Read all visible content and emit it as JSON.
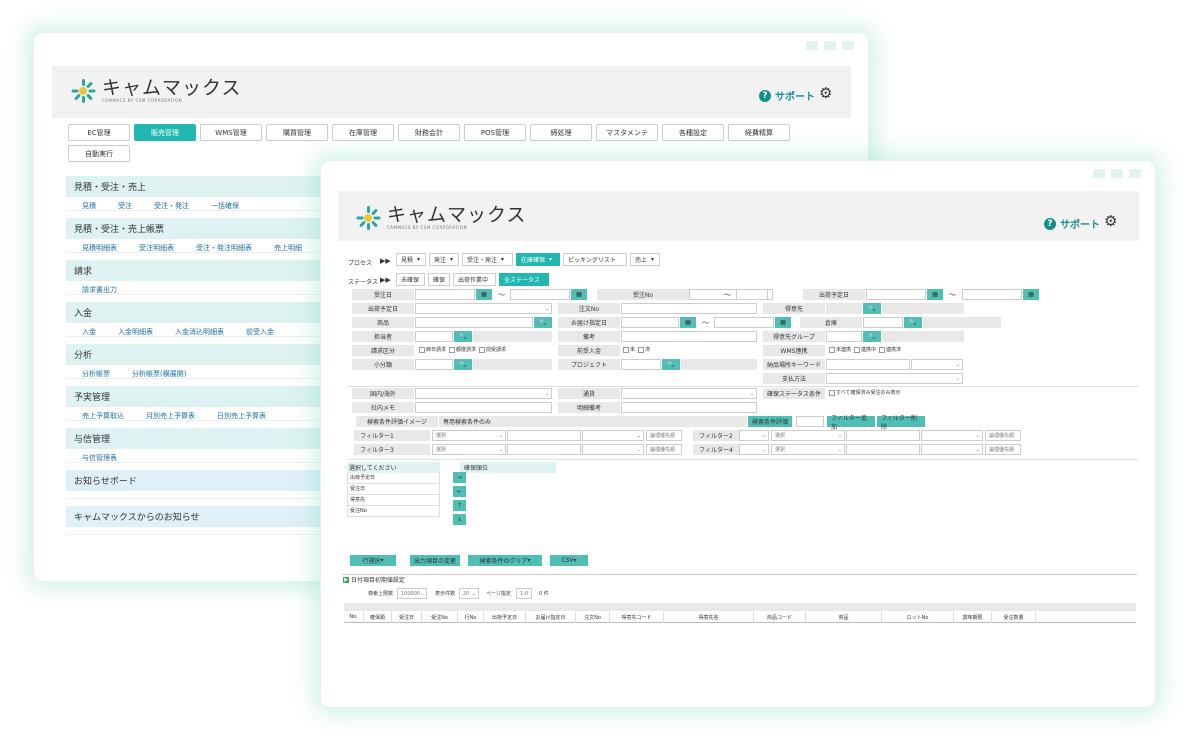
{
  "brand": {
    "name": "キャムマックス",
    "tagline": "CAMMACS BY CSM CORPORATION"
  },
  "header": {
    "support": "サポート"
  },
  "back": {
    "tabs": [
      {
        "label": "EC管理"
      },
      {
        "label": "販売管理",
        "active": true
      },
      {
        "label": "WMS管理"
      },
      {
        "label": "購買管理"
      },
      {
        "label": "在庫管理"
      },
      {
        "label": "財務会計"
      },
      {
        "label": "POS管理"
      },
      {
        "label": "締処理"
      },
      {
        "label": "マスタメンテ"
      },
      {
        "label": "各種設定"
      },
      {
        "label": "経費精算"
      },
      {
        "label": "自動実行"
      }
    ],
    "sections": [
      {
        "title": "見積・受注・売上",
        "links": [
          "見積",
          "受注",
          "受注・発注",
          "一括確保"
        ]
      },
      {
        "title": "見積・受注・売上帳票",
        "links": [
          "見積明細表",
          "受注明細表",
          "受注・発注明細表",
          "売上明細"
        ]
      },
      {
        "title": "請求",
        "links": [
          "請求書出力"
        ]
      },
      {
        "title": "入金",
        "links": [
          "入金",
          "入金明細表",
          "入金消込明細表",
          "前受入金"
        ]
      },
      {
        "title": "分析",
        "links": [
          "分析帳票",
          "分析帳票(横展開)"
        ]
      },
      {
        "title": "予実管理",
        "links": [
          "売上予算取込",
          "月別売上予算表",
          "日別売上予算表"
        ]
      },
      {
        "title": "与信管理",
        "links": [
          "与信管理表"
        ]
      },
      {
        "title": "お知らせボード",
        "links": []
      },
      {
        "title": "キャムマックスからのお知らせ",
        "links": []
      }
    ]
  },
  "front": {
    "process": {
      "label": "プロセス",
      "arrows": "▶▶",
      "buttons": [
        {
          "label": "見積",
          "drop": true
        },
        {
          "label": "発注",
          "drop": true
        },
        {
          "label": "受注・発注",
          "drop": true
        },
        {
          "label": "在庫確保",
          "drop": true,
          "active": true
        },
        {
          "label": "ピッキングリスト",
          "drop": false
        },
        {
          "label": "売上",
          "drop": true
        }
      ]
    },
    "status": {
      "label": "ステータス",
      "arrows": "▶▶",
      "buttons": [
        {
          "label": "未確保"
        },
        {
          "label": "確保"
        },
        {
          "label": "出荷作業中"
        },
        {
          "label": "全ステータス",
          "active": true
        }
      ]
    },
    "fields": {
      "juchubi": "受注日",
      "tilde": "～",
      "juchu_no": "受注No",
      "shukka_yotei": "出荷予定日",
      "shukka_yoteibi": "出荷予定日",
      "chumon_no": "注文No",
      "tokuisaki": "得意先",
      "shohin": "商品",
      "otodoke": "お届け指定日",
      "soko": "倉庫",
      "tantosha": "担当者",
      "biko": "備考",
      "tokuisaki_group": "得意先グループ",
      "seikyu_kubun": "請求区分",
      "seikyu_opts": [
        "締日請求",
        "都度請求",
        "前受請求"
      ],
      "maeuke": "前受入金",
      "maeuke_opts": [
        "未",
        "済"
      ],
      "wms": "WMS連携",
      "wms_opts": [
        "未連携",
        "連携中",
        "連携済"
      ],
      "shobunrui": "小分類",
      "project": "プロジェクト",
      "keyword": "納品場所キーワード",
      "shiharai": "支払方法",
      "kokunai": "国内/海外",
      "tsuka": "通貨",
      "kakuho_joken": "確保ステータス条件",
      "kakuho_opt": "すべて確保済み受注のみ表示",
      "shanai_memo": "社内メモ",
      "meisai_biko": "明細備考",
      "kensaku_image": "検索条件評価イメージ",
      "kensaku_value": "専用検索条件のみ",
      "kensaku_hyoka": "検索条件評価",
      "filter_add": "フィルター追加",
      "filter_del": "フィルター削除",
      "filters": [
        "フィルター1",
        "フィルター2",
        "フィルター3",
        "フィルター4"
      ],
      "select": "選択",
      "ronri": "論理優先順"
    },
    "order": {
      "left_title": "選択してください",
      "left_items": [
        "出荷予定日",
        "受注日",
        "得意先",
        "受注No"
      ],
      "right_title": "確保順位",
      "arrows": [
        "→",
        "←",
        "↑",
        "↓"
      ]
    },
    "actions": [
      "行選択",
      "出力項目の変更",
      "検索条件のクリア",
      "CSV"
    ],
    "date_setting": "日付項目初期値設定",
    "paging": {
      "max_label": "検索上限数",
      "max_value": "100000",
      "per_label": "表示件数",
      "per_value": "20",
      "page_label": "ページ指定",
      "page_value": "1-0",
      "count": "0 件"
    },
    "columns": [
      "No.",
      "確保順",
      "受注日",
      "受注No",
      "行No",
      "出荷予定日",
      "お届け指定日",
      "注文No",
      "得意先コード",
      "得意先名",
      "商品コード",
      "商品",
      "ロットNo",
      "賞味期限",
      "受注数量"
    ]
  }
}
